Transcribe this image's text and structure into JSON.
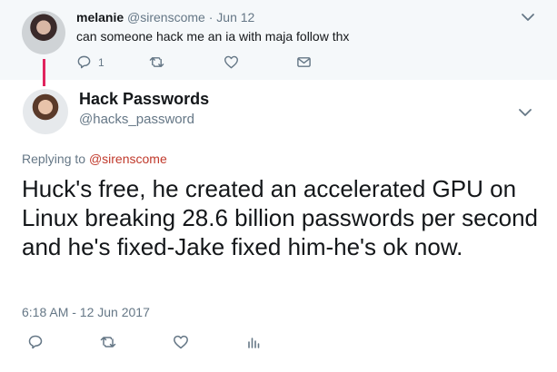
{
  "parent_tweet": {
    "name": "melanie",
    "handle": "@sirenscome",
    "separator": "·",
    "date": "Jun 12",
    "text": "can someone hack me an ia with maja follow thx",
    "reply_count": "1"
  },
  "main_tweet": {
    "name": "Hack Passwords",
    "handle": "@hacks_password",
    "replying_label": "Replying to",
    "replying_to": "@sirenscome",
    "text": "Huck's free, he created an accelerated GPU on Linux breaking 28.6 billion passwords per second and he's fixed-Jake fixed him-he's ok now.",
    "timestamp": "6:18 AM - 12 Jun 2017"
  },
  "colors": {
    "thread_line": "#e0245e",
    "secondary_text": "#657786",
    "reply_link": "#c0392b",
    "parent_bg": "#f5f8fa"
  },
  "icons": [
    "chevron-down-icon",
    "reply-icon",
    "retweet-icon",
    "like-icon",
    "message-icon",
    "analytics-icon"
  ]
}
